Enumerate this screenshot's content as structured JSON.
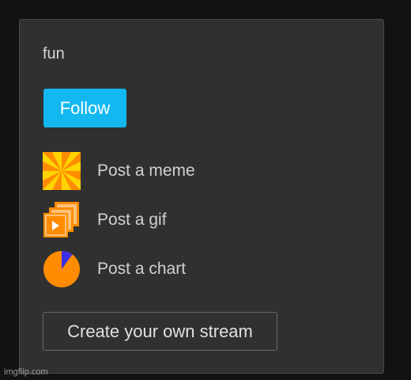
{
  "stream": {
    "title": "fun",
    "follow_label": "Follow"
  },
  "actions": [
    {
      "label": "Post a meme",
      "icon": "meme-pinwheel-icon"
    },
    {
      "label": "Post a gif",
      "icon": "gif-stack-icon"
    },
    {
      "label": "Post a chart",
      "icon": "pie-chart-icon"
    }
  ],
  "create_stream_label": "Create your own stream",
  "watermark": "imgflip.com",
  "colors": {
    "accent": "#13b8f0",
    "panel_bg": "#303030",
    "page_bg": "#121212",
    "icon_orange": "#ff8c00",
    "icon_yellow": "#ffd400",
    "chart_blue": "#3a2ee6"
  }
}
